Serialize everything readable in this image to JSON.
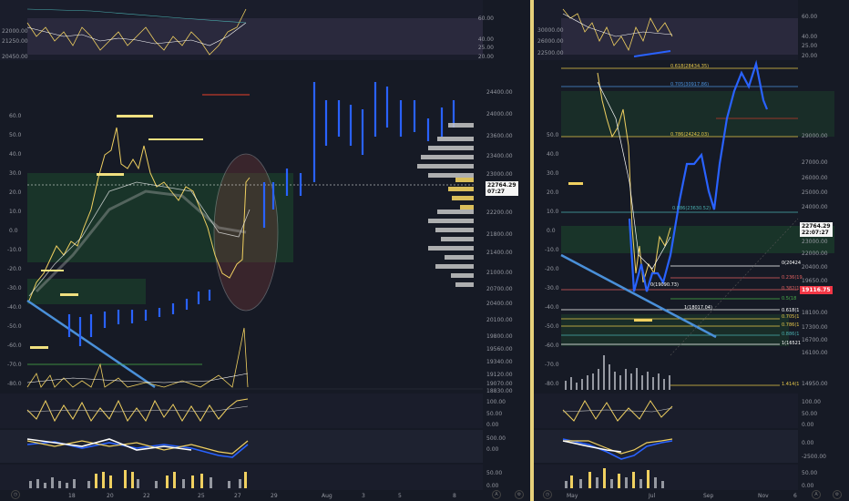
{
  "left": {
    "osc_top_scale": [
      "60.00",
      "40.00",
      "25.00",
      "20.00"
    ],
    "osc_top_price": [
      "22000.00",
      "21250.00",
      "20450.00"
    ],
    "main_y_left": [
      "60.0",
      "50.0",
      "40.0",
      "30.0",
      "20.0",
      "10.0",
      "0.0",
      "-10.0",
      "-20.0",
      "-30.0",
      "-40.0",
      "-50.0",
      "-60.0",
      "-70.0",
      "-80.0"
    ],
    "main_y_right": [
      "24400.00",
      "24000.00",
      "23600.00",
      "23400.00",
      "23000.00",
      "22200.00",
      "21800.00",
      "21400.00",
      "21000.00",
      "20700.00",
      "20400.00",
      "20100.00",
      "19800.00",
      "19560.00",
      "19340.00",
      "19120.00",
      "19070.00",
      "18830.00"
    ],
    "current_price": "22764.29",
    "countdown": "07:27",
    "rsi_scale": [
      "100.00",
      "50.00",
      "0.00"
    ],
    "macd_scale": [
      "500.00",
      "0.00"
    ],
    "vol_scale": [
      "50.00",
      "0.00"
    ],
    "time_labels": [
      "18",
      "20",
      "22",
      "25",
      "27",
      "29",
      "Aug",
      "3",
      "5",
      "8"
    ]
  },
  "right": {
    "osc_top_scale": [
      "60.00",
      "40.00",
      "25.00",
      "20.00"
    ],
    "osc_top_price": [
      "30000.00",
      "26000.00",
      "22500.00"
    ],
    "main_y_left": [
      "50.0",
      "40.0",
      "30.0",
      "20.0",
      "10.0",
      "0.0",
      "-10.0",
      "-20.0",
      "-30.0",
      "-40.0",
      "-50.0",
      "-60.0",
      "-70.0",
      "-80.0"
    ],
    "main_y_right": [
      "29000.00",
      "27000.00",
      "26000.00",
      "25000.00",
      "24000.00",
      "23000.00",
      "22000.00",
      "21000.00",
      "20400.00",
      "19650.00",
      "18100.00",
      "17300.00",
      "16700.00",
      "16100.00",
      "14950.00"
    ],
    "current_price": "22764.29",
    "countdown": "22:07:27",
    "red_price": "19116.75",
    "fib_labels": [
      {
        "text": "0.618(28434.35)",
        "color": "#e6c84a"
      },
      {
        "text": "0.705(30917.86)",
        "color": "#4a90d9"
      },
      {
        "text": "0.786(24242.03)",
        "color": "#e6c84a"
      },
      {
        "text": "0.886(23630.52)",
        "color": "#4ab0b0"
      },
      {
        "text": "0(20424",
        "color": "#ffffff"
      },
      {
        "text": "0.236(19",
        "color": "#e06060"
      },
      {
        "text": "0.382(19",
        "color": "#e06060"
      },
      {
        "text": "0.5(18",
        "color": "#4ab04a"
      },
      {
        "text": "1(18017.04)",
        "color": "#ffffff"
      },
      {
        "text": "0.618(1",
        "color": "#ffffff"
      },
      {
        "text": "0.705(1",
        "color": "#e6c84a"
      },
      {
        "text": "0.786(1",
        "color": "#e6c84a"
      },
      {
        "text": "0.886(1",
        "color": "#4ab0b0"
      },
      {
        "text": "1(16521",
        "color": "#ffffff"
      },
      {
        "text": "1.414(1",
        "color": "#e6c84a"
      },
      {
        "text": "0(19090.73)",
        "color": "#ffffff"
      }
    ],
    "rsi_scale": [
      "100.00",
      "50.00",
      "0.00"
    ],
    "macd_scale": [
      "0.00",
      "-2500.00"
    ],
    "vol_scale": [
      "50.00",
      "0.00"
    ],
    "time_labels": [
      "May",
      "Jul",
      "Sep",
      "Nov",
      "6"
    ]
  },
  "colors": {
    "bg": "#161a25",
    "yellow": "#f0d060",
    "blue": "#2962ff",
    "divider": "#e6d07a"
  }
}
